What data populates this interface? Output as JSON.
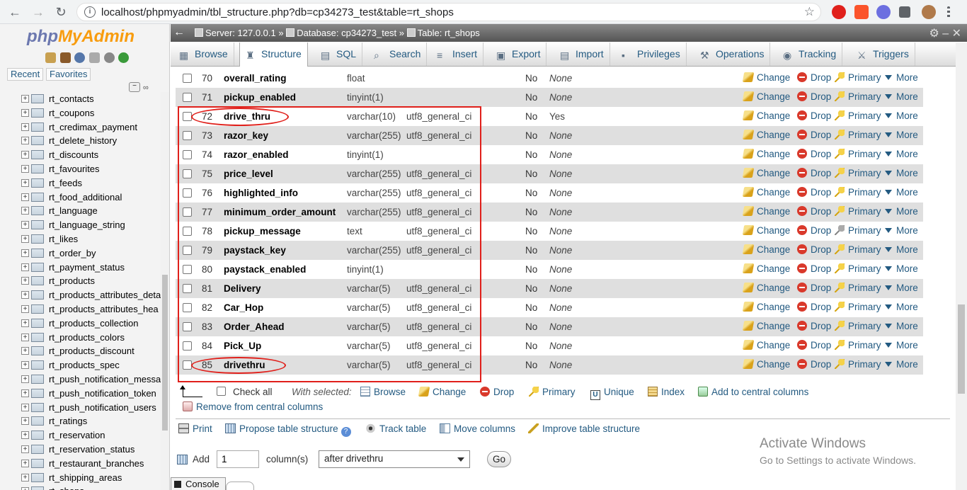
{
  "browser": {
    "url": "localhost/phpmyadmin/tbl_structure.php?db=cp34273_test&table=rt_shops",
    "back": "←",
    "forward": "→",
    "reload": "↻",
    "info_glyph": "i",
    "star": "☆"
  },
  "sidebar": {
    "logo_php": "php",
    "logo_myadmin": "MyAdmin",
    "recent": "Recent",
    "favorites": "Favorites",
    "collapse": "−",
    "link": "∞",
    "tables": [
      "rt_contacts",
      "rt_coupons",
      "rt_credimax_payment",
      "rt_delete_history",
      "rt_discounts",
      "rt_favourites",
      "rt_feeds",
      "rt_food_additional",
      "rt_language",
      "rt_language_string",
      "rt_likes",
      "rt_order_by",
      "rt_payment_status",
      "rt_products",
      "rt_products_attributes_deta",
      "rt_products_attributes_hea",
      "rt_products_collection",
      "rt_products_colors",
      "rt_products_discount",
      "rt_products_spec",
      "rt_push_notification_messa",
      "rt_push_notification_token",
      "rt_push_notification_users",
      "rt_ratings",
      "rt_reservation",
      "rt_reservation_status",
      "rt_restaurant_branches",
      "rt_shipping_areas",
      "rt_shops"
    ]
  },
  "topbar": {
    "server": "Server: 127.0.0.1",
    "database": "Database: cp34273_test",
    "table": "Table: rt_shops",
    "sep": "»",
    "collapse": "←",
    "settings": "⚙ – ✕"
  },
  "tabs": [
    {
      "label": "Browse",
      "icon": "▦"
    },
    {
      "label": "Structure",
      "icon": "♜"
    },
    {
      "label": "SQL",
      "icon": "▤"
    },
    {
      "label": "Search",
      "icon": "⌕"
    },
    {
      "label": "Insert",
      "icon": "≡"
    },
    {
      "label": "Export",
      "icon": "▣"
    },
    {
      "label": "Import",
      "icon": "▤"
    },
    {
      "label": "Privileges",
      "icon": "▪"
    },
    {
      "label": "Operations",
      "icon": "⚒"
    },
    {
      "label": "Tracking",
      "icon": "◉"
    },
    {
      "label": "Triggers",
      "icon": "⚔"
    }
  ],
  "actions": {
    "change": "Change",
    "drop": "Drop",
    "primary": "Primary",
    "more": "More"
  },
  "rows": [
    {
      "num": "70",
      "name": "overall_rating",
      "type": "float",
      "collation": "",
      "null": "No",
      "default": "None"
    },
    {
      "num": "71",
      "name": "pickup_enabled",
      "type": "tinyint(1)",
      "collation": "",
      "null": "No",
      "default": "None"
    },
    {
      "num": "72",
      "name": "drive_thru",
      "type": "varchar(10)",
      "collation": "utf8_general_ci",
      "null": "No",
      "default": "Yes"
    },
    {
      "num": "73",
      "name": "razor_key",
      "type": "varchar(255)",
      "collation": "utf8_general_ci",
      "null": "No",
      "default": "None"
    },
    {
      "num": "74",
      "name": "razor_enabled",
      "type": "tinyint(1)",
      "collation": "",
      "null": "No",
      "default": "None"
    },
    {
      "num": "75",
      "name": "price_level",
      "type": "varchar(255)",
      "collation": "utf8_general_ci",
      "null": "No",
      "default": "None"
    },
    {
      "num": "76",
      "name": "highlighted_info",
      "type": "varchar(255)",
      "collation": "utf8_general_ci",
      "null": "No",
      "default": "None"
    },
    {
      "num": "77",
      "name": "minimum_order_amount",
      "type": "varchar(255)",
      "collation": "utf8_general_ci",
      "null": "No",
      "default": "None"
    },
    {
      "num": "78",
      "name": "pickup_message",
      "type": "text",
      "collation": "utf8_general_ci",
      "null": "No",
      "default": "None"
    },
    {
      "num": "79",
      "name": "paystack_key",
      "type": "varchar(255)",
      "collation": "utf8_general_ci",
      "null": "No",
      "default": "None"
    },
    {
      "num": "80",
      "name": "paystack_enabled",
      "type": "tinyint(1)",
      "collation": "",
      "null": "No",
      "default": "None"
    },
    {
      "num": "81",
      "name": "Delivery",
      "type": "varchar(5)",
      "collation": "utf8_general_ci",
      "null": "No",
      "default": "None"
    },
    {
      "num": "82",
      "name": "Car_Hop",
      "type": "varchar(5)",
      "collation": "utf8_general_ci",
      "null": "No",
      "default": "None"
    },
    {
      "num": "83",
      "name": "Order_Ahead",
      "type": "varchar(5)",
      "collation": "utf8_general_ci",
      "null": "No",
      "default": "None"
    },
    {
      "num": "84",
      "name": "Pick_Up",
      "type": "varchar(5)",
      "collation": "utf8_general_ci",
      "null": "No",
      "default": "None"
    },
    {
      "num": "85",
      "name": "drivethru",
      "type": "varchar(5)",
      "collation": "utf8_general_ci",
      "null": "No",
      "default": "None"
    }
  ],
  "bulk": {
    "check_all": "Check all",
    "with_selected": "With selected:",
    "browse": "Browse",
    "change": "Change",
    "drop": "Drop",
    "primary": "Primary",
    "unique": "Unique",
    "unique_glyph": "U",
    "index": "Index",
    "add_central": "Add to central columns",
    "remove_central": "Remove from central columns"
  },
  "tools": {
    "print": "Print",
    "propose": "Propose table structure",
    "help_glyph": "?",
    "track": "Track table",
    "move": "Move columns",
    "improve": "Improve table structure"
  },
  "add_columns": {
    "label": "Add",
    "count": "1",
    "unit": "column(s)",
    "position": "after drivethru",
    "go": "Go"
  },
  "watermark": {
    "title": "Activate Windows",
    "subtitle": "Go to Settings to activate Windows."
  },
  "console": {
    "label": "Console"
  }
}
